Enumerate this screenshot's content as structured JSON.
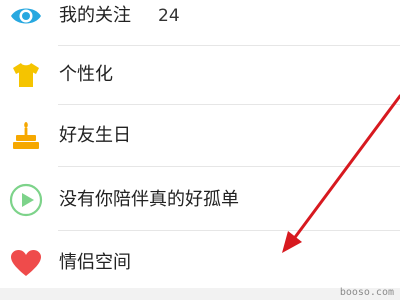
{
  "menu": {
    "items": [
      {
        "icon": "eye-icon",
        "label": "我的关注",
        "count": "24"
      },
      {
        "icon": "tshirt-icon",
        "label": "个性化"
      },
      {
        "icon": "birthday-cake-icon",
        "label": "好友生日"
      },
      {
        "icon": "play-circle-icon",
        "label": "没有你陪伴真的好孤单"
      },
      {
        "icon": "heart-icon",
        "label": "情侣空间"
      }
    ]
  },
  "watermark": "booso.com",
  "colors": {
    "eye_icon": "#27a8e0",
    "tshirt_icon": "#f5c400",
    "cake_icon": "#f6a800",
    "play_icon": "#7dd38a",
    "heart_icon": "#ef4b4b",
    "annotation_arrow": "#d7191f",
    "divider": "#e6e6e6"
  }
}
